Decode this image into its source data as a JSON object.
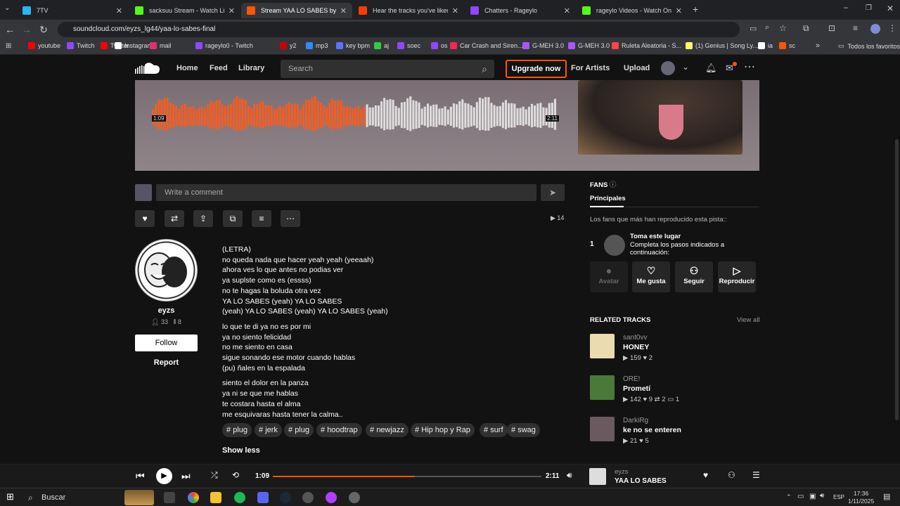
{
  "browser": {
    "tabs": [
      {
        "title": "7TV",
        "color": "#29b6f6",
        "active": false
      },
      {
        "title": "sacksuu Stream - Watch Live on",
        "color": "#53fc18",
        "active": false
      },
      {
        "title": "Stream YAA LO SABES by eyzs",
        "color": "#ff5500",
        "active": true
      },
      {
        "title": "Hear the tracks you've liked: on",
        "color": "#ff3d00",
        "active": false
      },
      {
        "title": "Chatters - Rageylo",
        "color": "#9146ff",
        "active": false
      },
      {
        "title": "rageylo Videos - Watch On-De",
        "color": "#53fc18",
        "active": false
      }
    ],
    "url": "soundcloud.com/eyzs_lg44/yaa-lo-sabes-final",
    "bookmarks": [
      {
        "label": "youtube",
        "color": "#ff0000"
      },
      {
        "label": "Twitch",
        "color": "#9146ff"
      },
      {
        "label": "Twitter",
        "color": "#ff0000"
      },
      {
        "label": "Instagram",
        "color": "#ffffff"
      },
      {
        "label": "mail",
        "color": "#e1306c"
      },
      {
        "label": "rageylo0 - Twitch",
        "color": "#9146ff"
      },
      {
        "label": "y2",
        "color": "#c00"
      },
      {
        "label": "mp3",
        "color": "#2a8cff"
      },
      {
        "label": "key bpm",
        "color": "#5577ff"
      },
      {
        "label": "aj",
        "color": "#2ecc40"
      },
      {
        "label": "soec",
        "color": "#9146ff"
      },
      {
        "label": "os",
        "color": "#9146ff"
      },
      {
        "label": "Car Crash and Siren...",
        "color": "#ff2255"
      },
      {
        "label": "G-MEH 3.0",
        "color": "#aa55ff"
      },
      {
        "label": "G-MEH 3.0",
        "color": "#aa55ff"
      },
      {
        "label": "Ruleta Aleatoria - S...",
        "color": "#ff4444"
      },
      {
        "label": "(1) Genius | Song Ly...",
        "color": "#ffff64"
      },
      {
        "label": "ia",
        "color": "#ffffff"
      },
      {
        "label": "sc",
        "color": "#ff5500"
      }
    ],
    "other_bookmarks": "Todos los favoritos"
  },
  "header": {
    "nav": [
      "Home",
      "Feed",
      "Library"
    ],
    "search_placeholder": "Search",
    "upgrade": "Upgrade now",
    "for_artists": "For Artists",
    "upload": "Upload"
  },
  "waveform": {
    "current": "1:09",
    "total": "2:11",
    "played_fraction": 0.53
  },
  "comment": {
    "placeholder": "Write a comment"
  },
  "plays": "14",
  "artist": {
    "name": "eyzs",
    "followers": "33",
    "tracks": "8",
    "follow": "Follow",
    "report": "Report"
  },
  "lyrics": [
    [
      "(LETRA)",
      "no queda nada que hacer yeah yeah (yeeaah)",
      "ahora ves lo que antes no podias ver",
      "ya suplste como es (essss)",
      "no te hagas la boluda otra vez",
      "YA LO SABES (yeah) YA LO SABES",
      "(yeah) YA LO SABES (yeah) YA LO SABES (yeah)"
    ],
    [
      "lo que te di ya no es por mi",
      "ya no siento felicidad",
      "no me siento en casa",
      "sigue sonando ese motor cuando hablas",
      "(pu) ñales en la espalada"
    ],
    [
      "siento el dolor en la panza",
      "ya ni se que me hablas",
      "te costara hasta el alma",
      "me esquivaras hasta tener la calma.."
    ]
  ],
  "tags": [
    "plug",
    "jerk",
    "plug",
    "hoodtrap",
    "newjazz",
    "Hip hop y Rap",
    "surf",
    "swag"
  ],
  "show_less": "Show less",
  "fans": {
    "title": "FANS",
    "tab": "Principales",
    "description": "Los fans que más han reproducido esta pista::",
    "rank": "1",
    "slot_title": "Toma este lugar",
    "slot_sub": "Completa los pasos indicados a continuación:",
    "buttons": [
      "Avatar",
      "Me gusta",
      "Seguir",
      "Reproducir"
    ]
  },
  "related": {
    "title": "RELATED TRACKS",
    "view_all": "View all",
    "tracks": [
      {
        "artist": "sant0vv",
        "title": "HONEY",
        "plays": "159",
        "likes": "2",
        "reposts": "",
        "comments": "",
        "color": "#e8dcb0"
      },
      {
        "artist": "ORE!",
        "title": "Prometí",
        "plays": "142",
        "likes": "9",
        "reposts": "2",
        "comments": "1",
        "color": "#4a7a3a"
      },
      {
        "artist": "DarkiRg",
        "title": "ke no se enteren",
        "plays": "21",
        "likes": "5",
        "reposts": "",
        "comments": "",
        "color": "#6a5a60"
      }
    ]
  },
  "player": {
    "current": "1:09",
    "total": "2:11",
    "progress": 0.53,
    "artist": "eyzs",
    "title": "YAA LO SABES"
  },
  "taskbar": {
    "search": "Buscar",
    "lang": "ESP",
    "time": "17:36",
    "date": "1/11/2025"
  }
}
